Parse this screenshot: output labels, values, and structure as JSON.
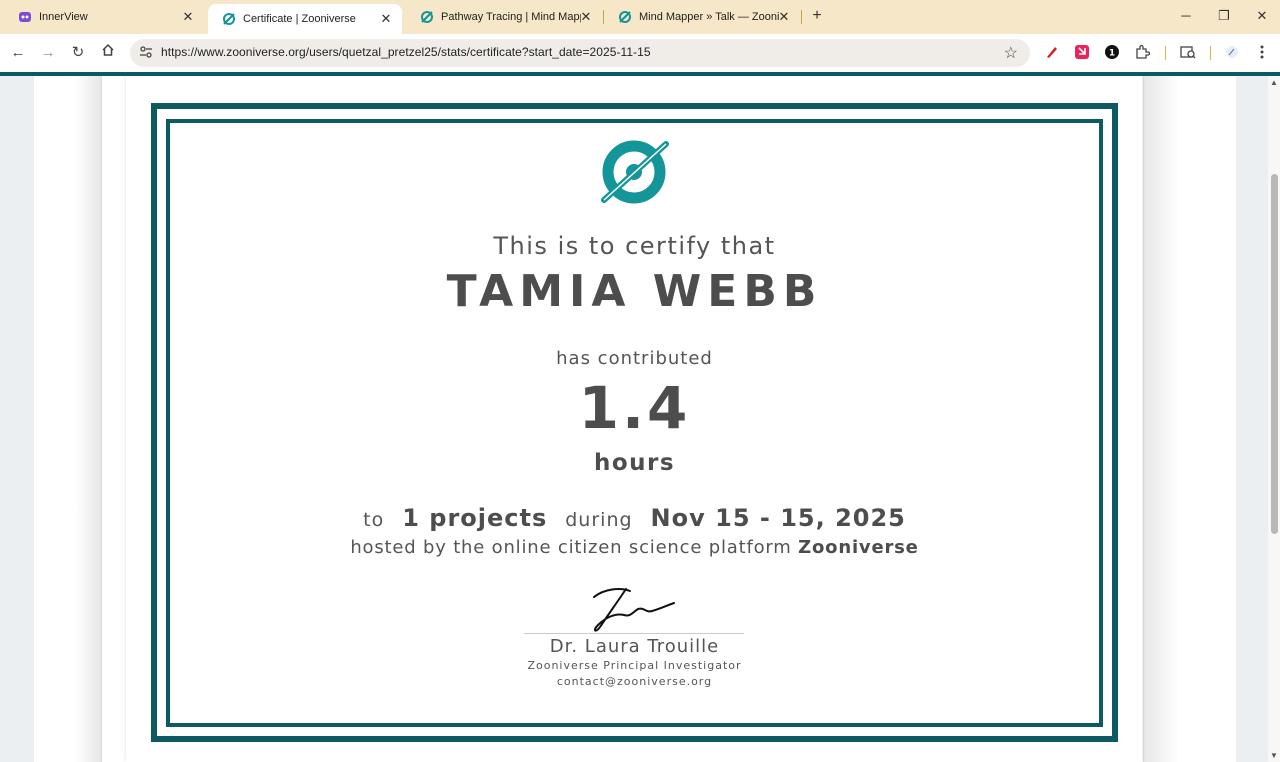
{
  "browser": {
    "tabs": [
      {
        "label": "InnerView",
        "icon": "innerview-icon"
      },
      {
        "label": "Certificate | Zooniverse",
        "icon": "zooniverse-icon",
        "active": true
      },
      {
        "label": "Pathway Tracing | Mind Mapper",
        "icon": "zooniverse-icon"
      },
      {
        "label": "Mind Mapper » Talk — Zooniverse",
        "icon": "zooniverse-icon"
      }
    ],
    "new_tab": "+",
    "url": "https://www.zooniverse.org/users/quetzal_pretzel25/stats/certificate?start_date=2025-11-15",
    "extension_badge": "1",
    "accent_color": "#0d5a62",
    "tabstrip_color": "#f5e7c8"
  },
  "certificate": {
    "certify_text": "This is to certify that",
    "name": "TAMIA WEBB",
    "contributed_text": "has contributed",
    "hours_value": "1.4",
    "hours_unit": "hours",
    "to_text": "to",
    "projects_text": "1 projects",
    "during_text": "during",
    "date_range": "Nov 15 - 15, 2025",
    "hosted_text": "hosted by the online citizen science platform",
    "platform_name": "Zooniverse",
    "signer_name": "Dr. Laura Trouille",
    "signer_role": "Zooniverse Principal Investigator",
    "signer_email": "contact@zooniverse.org"
  }
}
